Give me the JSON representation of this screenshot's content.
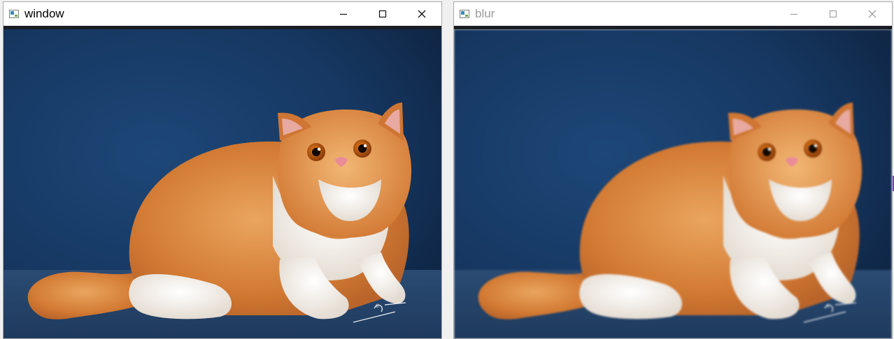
{
  "windows": [
    {
      "title": "window",
      "active": true,
      "image": "cat-photo",
      "controls": [
        "minimize-icon",
        "maximize-icon",
        "close-icon"
      ]
    },
    {
      "title": "blur",
      "active": false,
      "image": "cat-photo-blurred",
      "controls": [
        "minimize-icon",
        "maximize-icon",
        "close-icon"
      ]
    }
  ],
  "image_content": {
    "signature": "©"
  },
  "colors": {
    "background_top": "#1c3350",
    "background_mid": "#16355c",
    "floor": "#2a4a72",
    "fur_orange": "#d9823c",
    "fur_light": "#f2c08a",
    "fur_white": "#f3efe9",
    "eye": "#b5520c"
  }
}
